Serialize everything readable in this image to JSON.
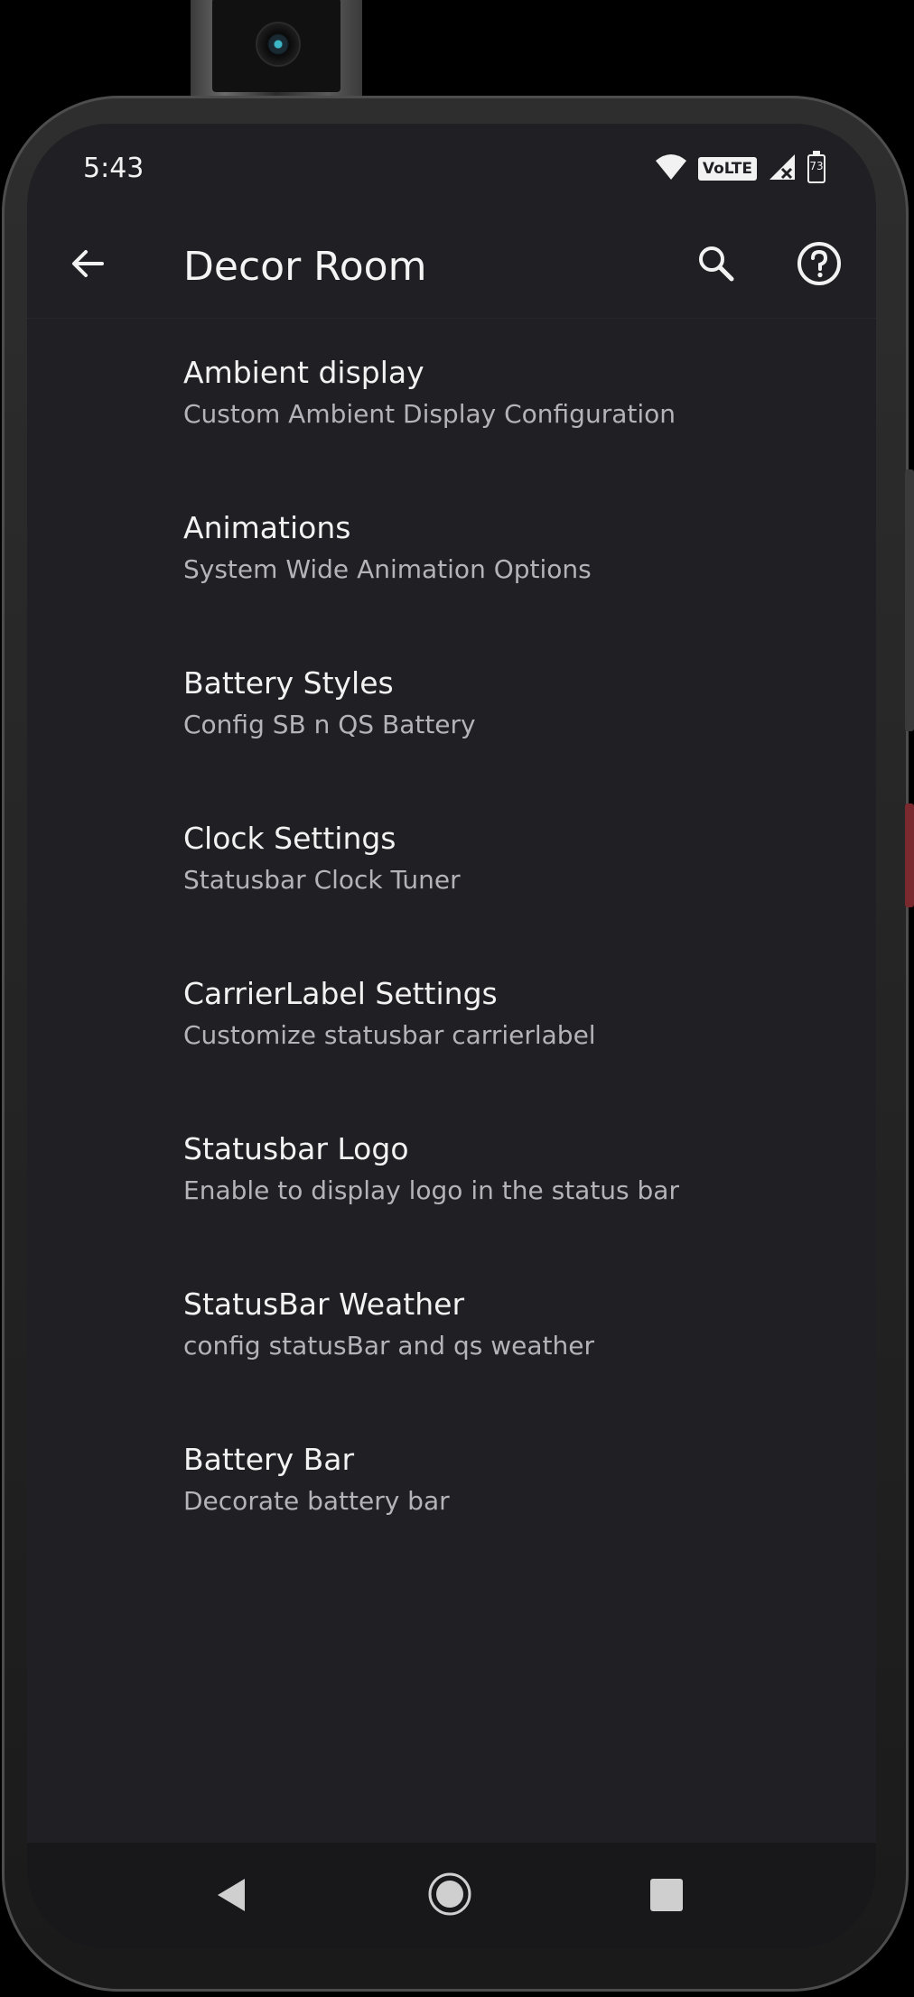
{
  "status_bar": {
    "time": "5:43",
    "network_badge": "VoLTE",
    "battery_level": "73",
    "icons": [
      "wifi-icon",
      "volte-icon",
      "signal-icon",
      "battery-icon"
    ]
  },
  "toolbar": {
    "title": "Decor Room",
    "icons": [
      "back-arrow-icon",
      "search-icon",
      "help-icon"
    ]
  },
  "settings": [
    {
      "title": "Ambient display",
      "summary": "Custom Ambient Display Configuration"
    },
    {
      "title": "Animations",
      "summary": "System Wide Animation Options"
    },
    {
      "title": "Battery Styles",
      "summary": "Config SB n QS Battery"
    },
    {
      "title": "Clock Settings",
      "summary": "Statusbar Clock Tuner"
    },
    {
      "title": "CarrierLabel Settings",
      "summary": "Customize statusbar carrierlabel"
    },
    {
      "title": "Statusbar Logo",
      "summary": "Enable to display logo in the status bar"
    },
    {
      "title": "StatusBar Weather",
      "summary": "config statusBar and qs weather"
    },
    {
      "title": "Battery Bar",
      "summary": "Decorate battery bar"
    }
  ],
  "nav_bar": {
    "icons": [
      "nav-back-icon",
      "nav-home-icon",
      "nav-recents-icon"
    ]
  },
  "colors": {
    "background": "#202024",
    "text_primary": "#f2f2f2",
    "text_secondary": "#b4b4b8",
    "nav_bar": "#18181b"
  }
}
